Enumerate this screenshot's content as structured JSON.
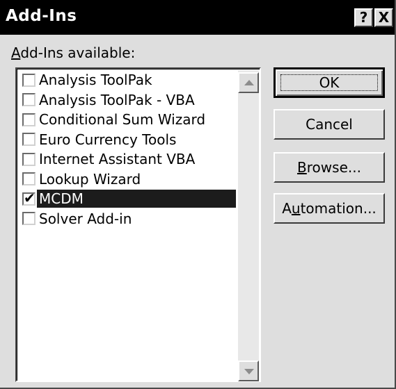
{
  "window": {
    "title": "Add-Ins",
    "help_button": "?",
    "close_button": "X"
  },
  "list": {
    "label_prefix": "A",
    "label_rest": "dd-Ins available:",
    "items": [
      {
        "label": "Analysis ToolPak",
        "checked": false,
        "selected": false
      },
      {
        "label": "Analysis ToolPak - VBA",
        "checked": false,
        "selected": false
      },
      {
        "label": "Conditional Sum Wizard",
        "checked": false,
        "selected": false
      },
      {
        "label": "Euro Currency Tools",
        "checked": false,
        "selected": false
      },
      {
        "label": "Internet Assistant VBA",
        "checked": false,
        "selected": false
      },
      {
        "label": "Lookup Wizard",
        "checked": false,
        "selected": false
      },
      {
        "label": "MCDM",
        "checked": true,
        "selected": true
      },
      {
        "label": "Solver Add-in",
        "checked": false,
        "selected": false
      }
    ]
  },
  "buttons": {
    "ok": "OK",
    "cancel": "Cancel",
    "browse_mnemonic": "B",
    "browse_rest": "rowse...",
    "automation_pre": "A",
    "automation_mnemonic": "u",
    "automation_rest": "tomation..."
  },
  "colors": {
    "title_bar": "#000000",
    "dialog_bg": "#dedede",
    "selection_bg": "#1c1c1c"
  }
}
